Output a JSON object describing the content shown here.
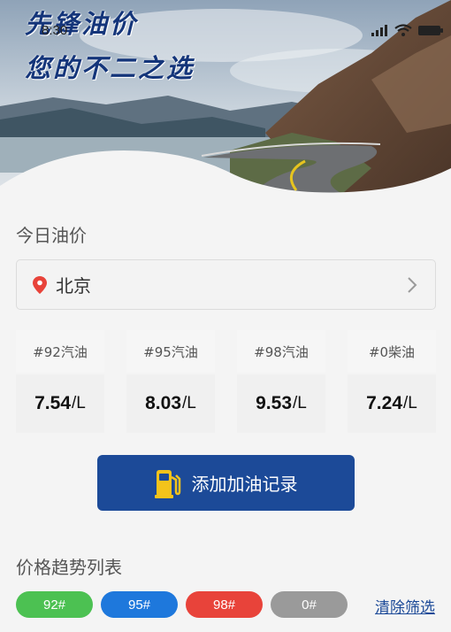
{
  "status_bar": {
    "time": "8:30"
  },
  "hero": {
    "line1": "先锋油价",
    "line2": "您的不二之选"
  },
  "today": {
    "title": "今日油价",
    "city": "北京",
    "fuels": [
      {
        "label": "#92汽油",
        "price": "7.54",
        "unit": "/L"
      },
      {
        "label": "#95汽油",
        "price": "8.03",
        "unit": "/L"
      },
      {
        "label": "#98汽油",
        "price": "9.53",
        "unit": "/L"
      },
      {
        "label": "#0柴油",
        "price": "7.24",
        "unit": "/L"
      }
    ]
  },
  "add_button": {
    "label": "添加加油记录"
  },
  "trend": {
    "title": "价格趋势列表",
    "filters": [
      {
        "label": "92#",
        "color": "#4cc152"
      },
      {
        "label": "95#",
        "color": "#1e78dc"
      },
      {
        "label": "98#",
        "color": "#e8433a"
      },
      {
        "label": "0#",
        "color": "#9a9a9a"
      }
    ],
    "clear_label": "清除筛选"
  }
}
